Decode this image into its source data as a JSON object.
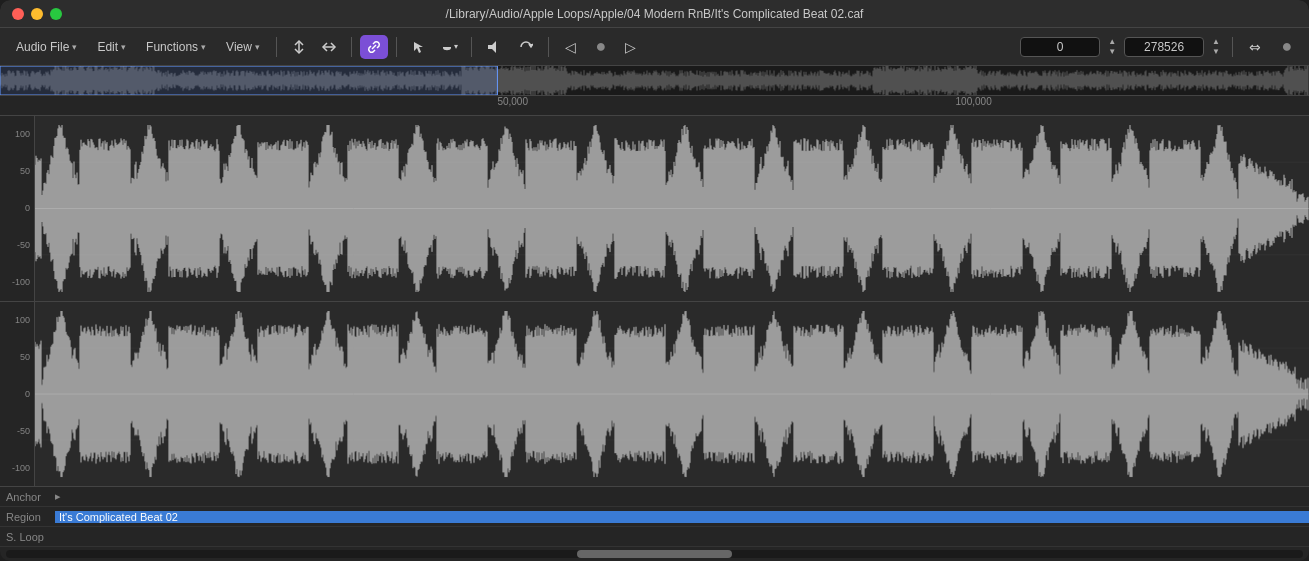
{
  "window": {
    "title": "/Library/Audio/Apple Loops/Apple/04 Modern RnB/It's Complicated Beat 02.caf"
  },
  "toolbar": {
    "audio_file_label": "Audio File",
    "edit_label": "Edit",
    "functions_label": "Functions",
    "view_label": "View",
    "position_value": "0",
    "length_value": "278526"
  },
  "ruler": {
    "markers": [
      "50,000",
      "100,000"
    ]
  },
  "channels": [
    {
      "labels": [
        "100",
        "50",
        "0",
        "-50",
        "-100"
      ]
    },
    {
      "labels": [
        "100",
        "50",
        "0",
        "-50",
        "-100"
      ]
    }
  ],
  "bottom": {
    "anchor_label": "Anchor",
    "region_label": "Region",
    "region_value": "It's Complicated Beat 02",
    "sloop_label": "S. Loop"
  },
  "icons": {
    "close": "●",
    "minimize": "●",
    "maximize": "●",
    "split": "⊘",
    "trim": "↔",
    "link": "🔗",
    "arrow": "↖",
    "hand": "✋",
    "speaker": "🔊",
    "loop": "↻",
    "vol_down": "◁",
    "circle": "●",
    "vol_up": "▷",
    "swap": "⇔",
    "stepper_up": "▲",
    "stepper_down": "▼"
  }
}
